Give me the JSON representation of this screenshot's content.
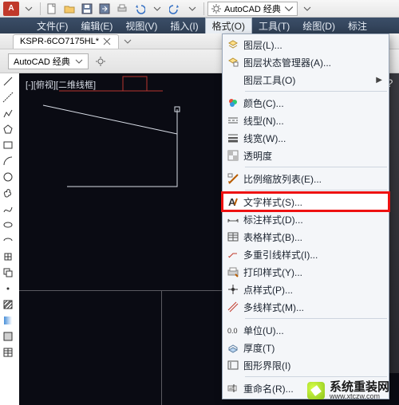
{
  "app": {
    "workspace_label": "AutoCAD 经典",
    "workspace_label2": "AutoCAD 经典"
  },
  "tab": {
    "title": "KSPR-6CO7175HL*"
  },
  "menubar": {
    "file": "文件(F)",
    "edit": "编辑(E)",
    "view": "视图(V)",
    "insert": "插入(I)",
    "format": "格式(O)",
    "tools": "工具(T)",
    "draw": "绘图(D)",
    "dimension": "标注"
  },
  "viewport": {
    "label": "[-][俯视][二维线框]"
  },
  "format_menu": {
    "layer": "图层(L)...",
    "layer_state": "图层状态管理器(A)...",
    "layer_tools": "图层工具(O)",
    "color": "颜色(C)...",
    "linetype": "线型(N)...",
    "lineweight": "线宽(W)...",
    "transparency": "透明度",
    "scale_list": "比例缩放列表(E)...",
    "text_style": "文字样式(S)...",
    "dim_style": "标注样式(D)...",
    "table_style": "表格样式(B)...",
    "mleader_style": "多重引线样式(I)...",
    "plot_style": "打印样式(Y)...",
    "point_style": "点样式(P)...",
    "mline_style": "多线样式(M)...",
    "units": "单位(U)...",
    "thickness": "厚度(T)",
    "limits": "图形界限(I)",
    "rename": "重命名(R)..."
  },
  "watermark": {
    "brand": "系统重装网",
    "url": "www.xtczw.com"
  },
  "right_palette": {
    "help": "?"
  },
  "icons": {
    "autocad_logo": "A"
  }
}
